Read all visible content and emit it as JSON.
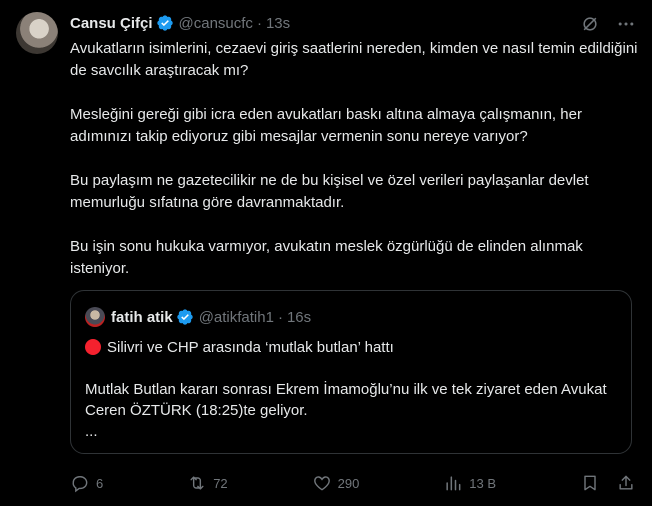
{
  "tweet": {
    "author_name": "Cansu Çifçi",
    "handle": "@cansucfc",
    "separator": "·",
    "time": "13s",
    "paragraphs": [
      "Avukatların isimlerini, cezaevi giriş saatlerini nereden, kimden ve nasıl temin edildiğini de savcılık araştıracak mı?",
      "Mesleğini gereği gibi icra eden avukatları baskı altına almaya çalışmanın, her adımınızı takip ediyoruz gibi mesajlar vermenin sonu nereye varıyor?",
      "Bu paylaşım ne gazetecilikir ne de bu kişisel ve özel verileri paylaşanlar devlet memurluğu sıfatına göre davranmaktadır.",
      "Bu işin sonu hukuka varmıyor, avukatın meslek özgürlüğü de elinden alınmak isteniyor."
    ]
  },
  "quote": {
    "author_name": "fatih atik",
    "handle": "@atikfatih1",
    "separator": "·",
    "time": "16s",
    "line1": "Silivri ve CHP arasında ‘mutlak butlan’ hattı",
    "line2": "Mutlak Butlan kararı sonrası Ekrem İmamoğlu’nu ilk ve tek ziyaret eden Avukat Ceren ÖZTÜRK (18:25)te geliyor.",
    "line3": "..."
  },
  "actions": {
    "replies": "6",
    "reposts": "72",
    "likes": "290",
    "views": "13 B"
  },
  "colors": {
    "background": "#000000",
    "text": "#e7e9ea",
    "muted": "#71767b",
    "verified": "#1d9bf0",
    "red_dot": "#f4212e"
  },
  "icons": [
    "verified-badge-icon",
    "grok-icon",
    "more-icon",
    "reply-icon",
    "repost-icon",
    "like-icon",
    "views-icon",
    "bookmark-icon",
    "share-icon"
  ]
}
